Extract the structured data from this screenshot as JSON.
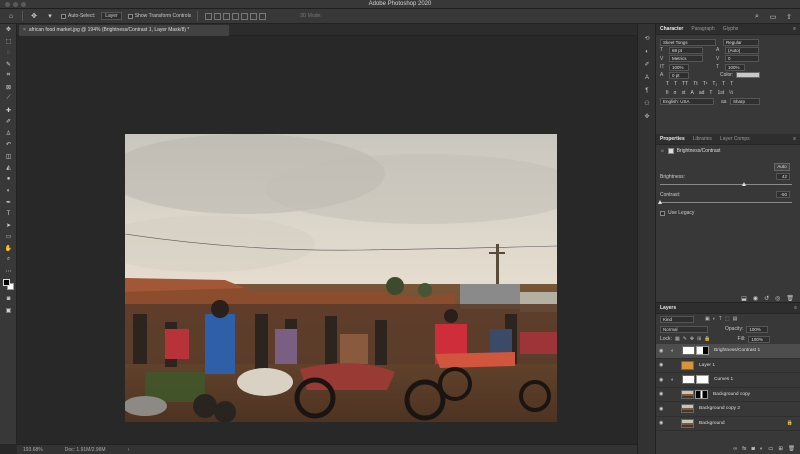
{
  "window": {
    "title": "Adobe Photoshop 2020"
  },
  "options_bar": {
    "auto_select_label": "Auto-Select:",
    "auto_select_target": "Layer",
    "transform_label": "Show Transform Controls",
    "mode_3d": "3D Mode:"
  },
  "document": {
    "tab_title": "african food market.jpg @ 194% (Brightness/Contrast 1, Layer Mask/8) *"
  },
  "status": {
    "zoom": "193.68%",
    "doc_info": "Doc: 1.91M/2.96M"
  },
  "character": {
    "tabs": [
      "Character",
      "Paragraph",
      "Glyphs"
    ],
    "font_family": "Skeet Tongs",
    "font_style": "Regular",
    "font_size": "68 pt",
    "leading": "(Auto)",
    "kerning": "Metrics",
    "tracking": "0",
    "vertical_scale": "100%",
    "horizontal_scale": "100%",
    "baseline_shift": "0 pt",
    "color_label": "Color:",
    "language": "English: USA",
    "antialias": "Sharp"
  },
  "properties": {
    "tabs": [
      "Properties",
      "Libraries",
      "Layer Comps"
    ],
    "adjustment_title": "Brightness/Contrast",
    "auto_label": "Auto",
    "brightness_label": "Brightness:",
    "brightness_value": "42",
    "brightness": 42,
    "contrast_label": "Contrast:",
    "contrast_value": "-50",
    "contrast": -50,
    "use_legacy_label": "Use Legacy"
  },
  "layers": {
    "tab": "Layers",
    "filter_kind": "Kind",
    "blend_mode": "Normal",
    "opacity_label": "Opacity:",
    "opacity": "100%",
    "lock_label": "Lock:",
    "fill_label": "Fill:",
    "fill": "100%",
    "items": [
      {
        "name": "Brightness/Contrast 1",
        "selected": true
      },
      {
        "name": "Layer 1"
      },
      {
        "name": "Curves 1"
      },
      {
        "name": "Background copy"
      },
      {
        "name": "Background copy 2"
      },
      {
        "name": "Background"
      }
    ]
  },
  "colors": {
    "app_bg": "#282828",
    "panel_bg": "#383838",
    "layer_orange": "#d9933a"
  }
}
